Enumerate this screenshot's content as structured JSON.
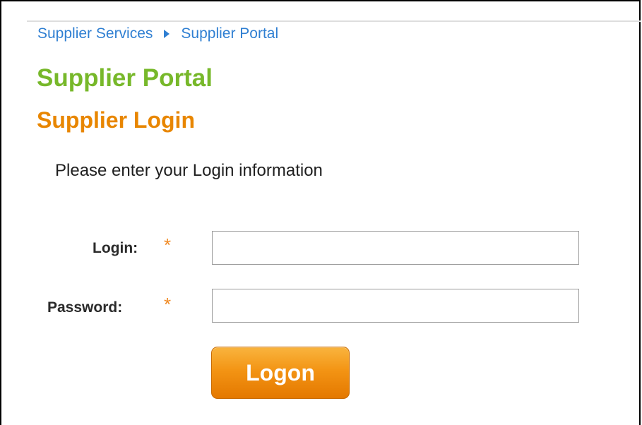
{
  "breadcrumb": {
    "items": [
      "Supplier Services",
      "Supplier Portal"
    ]
  },
  "header": {
    "title": "Supplier Portal",
    "subtitle": "Supplier Login"
  },
  "form": {
    "instructions": "Please enter your Login information",
    "fields": [
      {
        "label": "Login:",
        "value": "",
        "required_marker": "*"
      },
      {
        "label": "Password:",
        "value": "",
        "required_marker": "*"
      }
    ],
    "submit_label": "Logon"
  },
  "colors": {
    "link": "#2f7fd2",
    "title": "#77b82a",
    "subtitle": "#e88600",
    "required": "#f08a24",
    "button": "#f39414"
  },
  "icons": {
    "breadcrumb_separator": "triangle-right-icon"
  }
}
